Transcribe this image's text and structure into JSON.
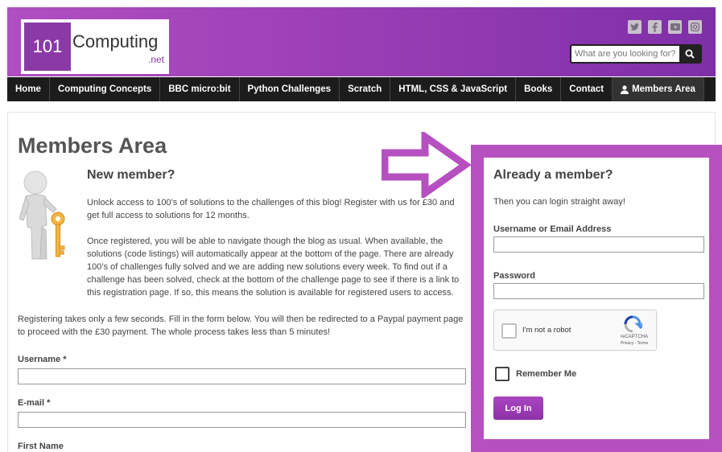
{
  "header": {
    "logo_number": "101",
    "logo_name": "Computing",
    "logo_suffix": ".net",
    "social_icons": [
      "twitter-icon",
      "facebook-icon",
      "youtube-icon",
      "instagram-icon"
    ],
    "search_placeholder": "What are you looking for?"
  },
  "nav": {
    "items": [
      {
        "label": "Home"
      },
      {
        "label": "Computing Concepts"
      },
      {
        "label": "BBC micro:bit"
      },
      {
        "label": "Python Challenges"
      },
      {
        "label": "Scratch"
      },
      {
        "label": "HTML, CSS & JavaScript"
      },
      {
        "label": "Books"
      },
      {
        "label": "Contact"
      },
      {
        "label": "Members Area",
        "icon": "user-icon"
      }
    ]
  },
  "main": {
    "page_title": "Members Area",
    "new_member_title": "New member?",
    "para1": "Unlock access to 100’s of solutions to the challenges of this blog! Register with us for £30 and get full access to solutions for 12 months.",
    "para2": "Once registered, you will be able to navigate though the blog as usual. When available, the solutions (code listings) will automatically appear at the bottom of the page. There are already 100’s of challenges fully solved and we are adding new solutions every week. To find out if a challenge has been solved, check at the bottom of the challenge page to see if there is a link to this registration page. If so, this means the solution is available for registered users to access.",
    "para3": "Registering takes only a few seconds. Fill in the form below. You will then be redirected to a Paypal payment page to proceed with the £30 payment. The whole process takes less than 5 minutes!",
    "username_label": "Username *",
    "email_label": "E-mail *",
    "firstname_label": "First Name"
  },
  "login": {
    "title": "Already a member?",
    "subtitle": "Then you can login straight away!",
    "username_label": "Username or Email Address",
    "password_label": "Password",
    "captcha_text": "I'm not a robot",
    "captcha_brand": "reCAPTCHA",
    "captcha_links": "Privacy - Terms",
    "remember_label": "Remember Me",
    "button_label": "Log In"
  },
  "colors": {
    "header_gradient_start": "#b04fc0",
    "header_gradient_end": "#7e2fa8",
    "accent": "#b650c0",
    "nav_bg": "#1c1c1c"
  }
}
